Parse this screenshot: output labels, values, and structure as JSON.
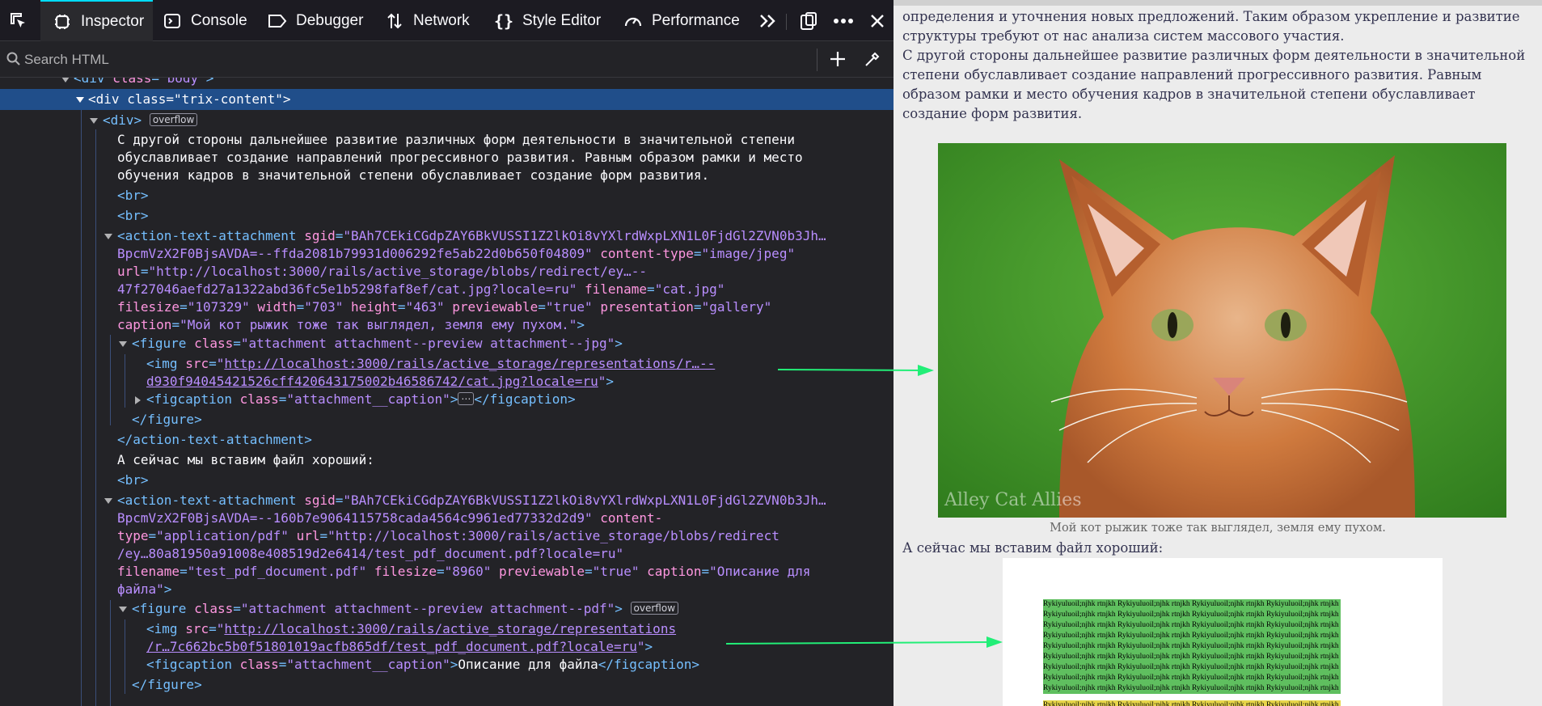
{
  "toolbar": {
    "tabs": [
      {
        "label": "Inspector",
        "icon": "inspector-icon",
        "selected": true
      },
      {
        "label": "Console",
        "icon": "console-icon"
      },
      {
        "label": "Debugger",
        "icon": "debugger-icon"
      },
      {
        "label": "Network",
        "icon": "network-icon"
      },
      {
        "label": "Style Editor",
        "icon": "style-editor-icon"
      },
      {
        "label": "Performance",
        "icon": "performance-icon"
      }
    ]
  },
  "search": {
    "placeholder": "Search HTML"
  },
  "tree": {
    "l0_tag": "div",
    "l0_attr": "class",
    "l0_val": "\"body\"",
    "l1_tag": "div",
    "l1_attr": "class",
    "l1_val": "\"trix-content\"",
    "l2_tag": "div",
    "l2_badge": "overflow",
    "t1": "С другой стороны дальнейшее развитие различных форм деятельности в значительной степени",
    "t2": "обуславливает создание направлений прогрессивного развития. Равным образом рамки и место",
    "t3": "обучения кадров в значительной степени обуславливает создание форм развития.",
    "br": "<br>",
    "a1": {
      "tag": "action-text-attachment",
      "sgid_name": "sgid",
      "sgid_val": "\"BAh7CEkiCGdpZAY6BkVUSSI1Z2lkOi8vYXlrdWxpLXN1L0FjdGl2ZVN0b3Jh…",
      "sgid_val2": "BpcmVzX2F0BjsAVDA=--ffda2081b79931d006292fe5ab22d0b650f04809\"",
      "ct_name": "content-type",
      "ct_val": "\"image/jpeg\"",
      "url_name": "url",
      "url_val": "\"http://localhost:3000/rails/active_storage/blobs/redirect/ey…--",
      "url_val2": "47f27046aefd27a1322abd36fc5e1b5298faf8ef/cat.jpg?locale=ru\"",
      "fn_name": "filename",
      "fn_val": "\"cat.jpg\"",
      "fs_name": "filesize",
      "fs_val": "\"107329\"",
      "w_name": "width",
      "w_val": "\"703\"",
      "h_name": "height",
      "h_val": "\"463\"",
      "pv_name": "previewable",
      "pv_val": "\"true\"",
      "pr_name": "presentation",
      "pr_val": "\"gallery\"",
      "cap_name": "caption",
      "cap_val": "\"Мой кот рыжик тоже так выглядел, земля ему пухом.\"",
      "fig_tag": "figure",
      "fig_attr": "class",
      "fig_val": "\"attachment attachment--preview attachment--jpg\"",
      "img_tag": "img",
      "img_attr": "src",
      "img_src1": "http://localhost:3000/rails/active_storage/representations/r…--",
      "img_src2": "d930f94045421526cff420643175002b46586742/cat.jpg?locale=ru",
      "figcap_tag": "figcaption",
      "figcap_attr": "class",
      "figcap_val": "\"attachment__caption\"",
      "close_fig": "</figure>",
      "close_ata": "</action-text-attachment>"
    },
    "t4": "А сейчас мы вставим файл хороший:",
    "a2": {
      "sgid_val": "\"BAh7CEkiCGdpZAY6BkVUSSI1Z2lkOi8vYXlrdWxpLXN1L0FjdGl2ZVN0b3Jh…",
      "sgid_val2": "BpcmVzX2F0BjsAVDA=--160b7e9064115758cada4564c9961ed77332d2d9\"",
      "ct_name1": "content-",
      "ct_name2": "type",
      "ct_val": "\"application/pdf\"",
      "url_val": "\"http://localhost:3000/rails/active_storage/blobs/redirect",
      "url_val2": "/ey…80a81950a91008e408519d2e6414/test_pdf_document.pdf?locale=ru\"",
      "fn_val": "\"test_pdf_document.pdf\"",
      "fs_val": "\"8960\"",
      "pv_val": "\"true\"",
      "cap_val": "\"Описание для",
      "cap_val2": "файла\"",
      "fig_val": "\"attachment attachment--preview attachment--pdf\"",
      "fig_badge": "overflow",
      "img_src1": "http://localhost:3000/rails/active_storage/representations",
      "img_src2": "/r…7c662bc5b0f51801019acfb865df/test_pdf_document.pdf?locale=ru",
      "figcap_text": "Описание для файла"
    }
  },
  "page": {
    "p1": "определения и уточнения новых предложений. Таким образом укрепление и развитие структуры требуют от нас анализа систем массового участия.",
    "p2": "С другой стороны дальнейшее развитие различных форм деятельности в значительной степени обуславливает создание направлений прогрессивного развития. Равным образом рамки и место обучения кадров в значительной степени обуславливает создание форм развития.",
    "cat_caption": "Мой кот рыжик тоже так выглядел, земля ему пухом.",
    "watermark": "Alley Cat Allies",
    "p3": "А сейчас мы вставим файл хороший:",
    "pdf_line": "Rykiyuluoil;njhk rtnjkh Rykiyuluoil;njhk rtnjkh Rykiyuluoil;njhk rtnjkh Rykiyuluoil;njhk rtnjkh"
  },
  "colors": {
    "accent": "#00ddff",
    "arrow": "#22ee77",
    "selected_row": "#204e8a"
  }
}
